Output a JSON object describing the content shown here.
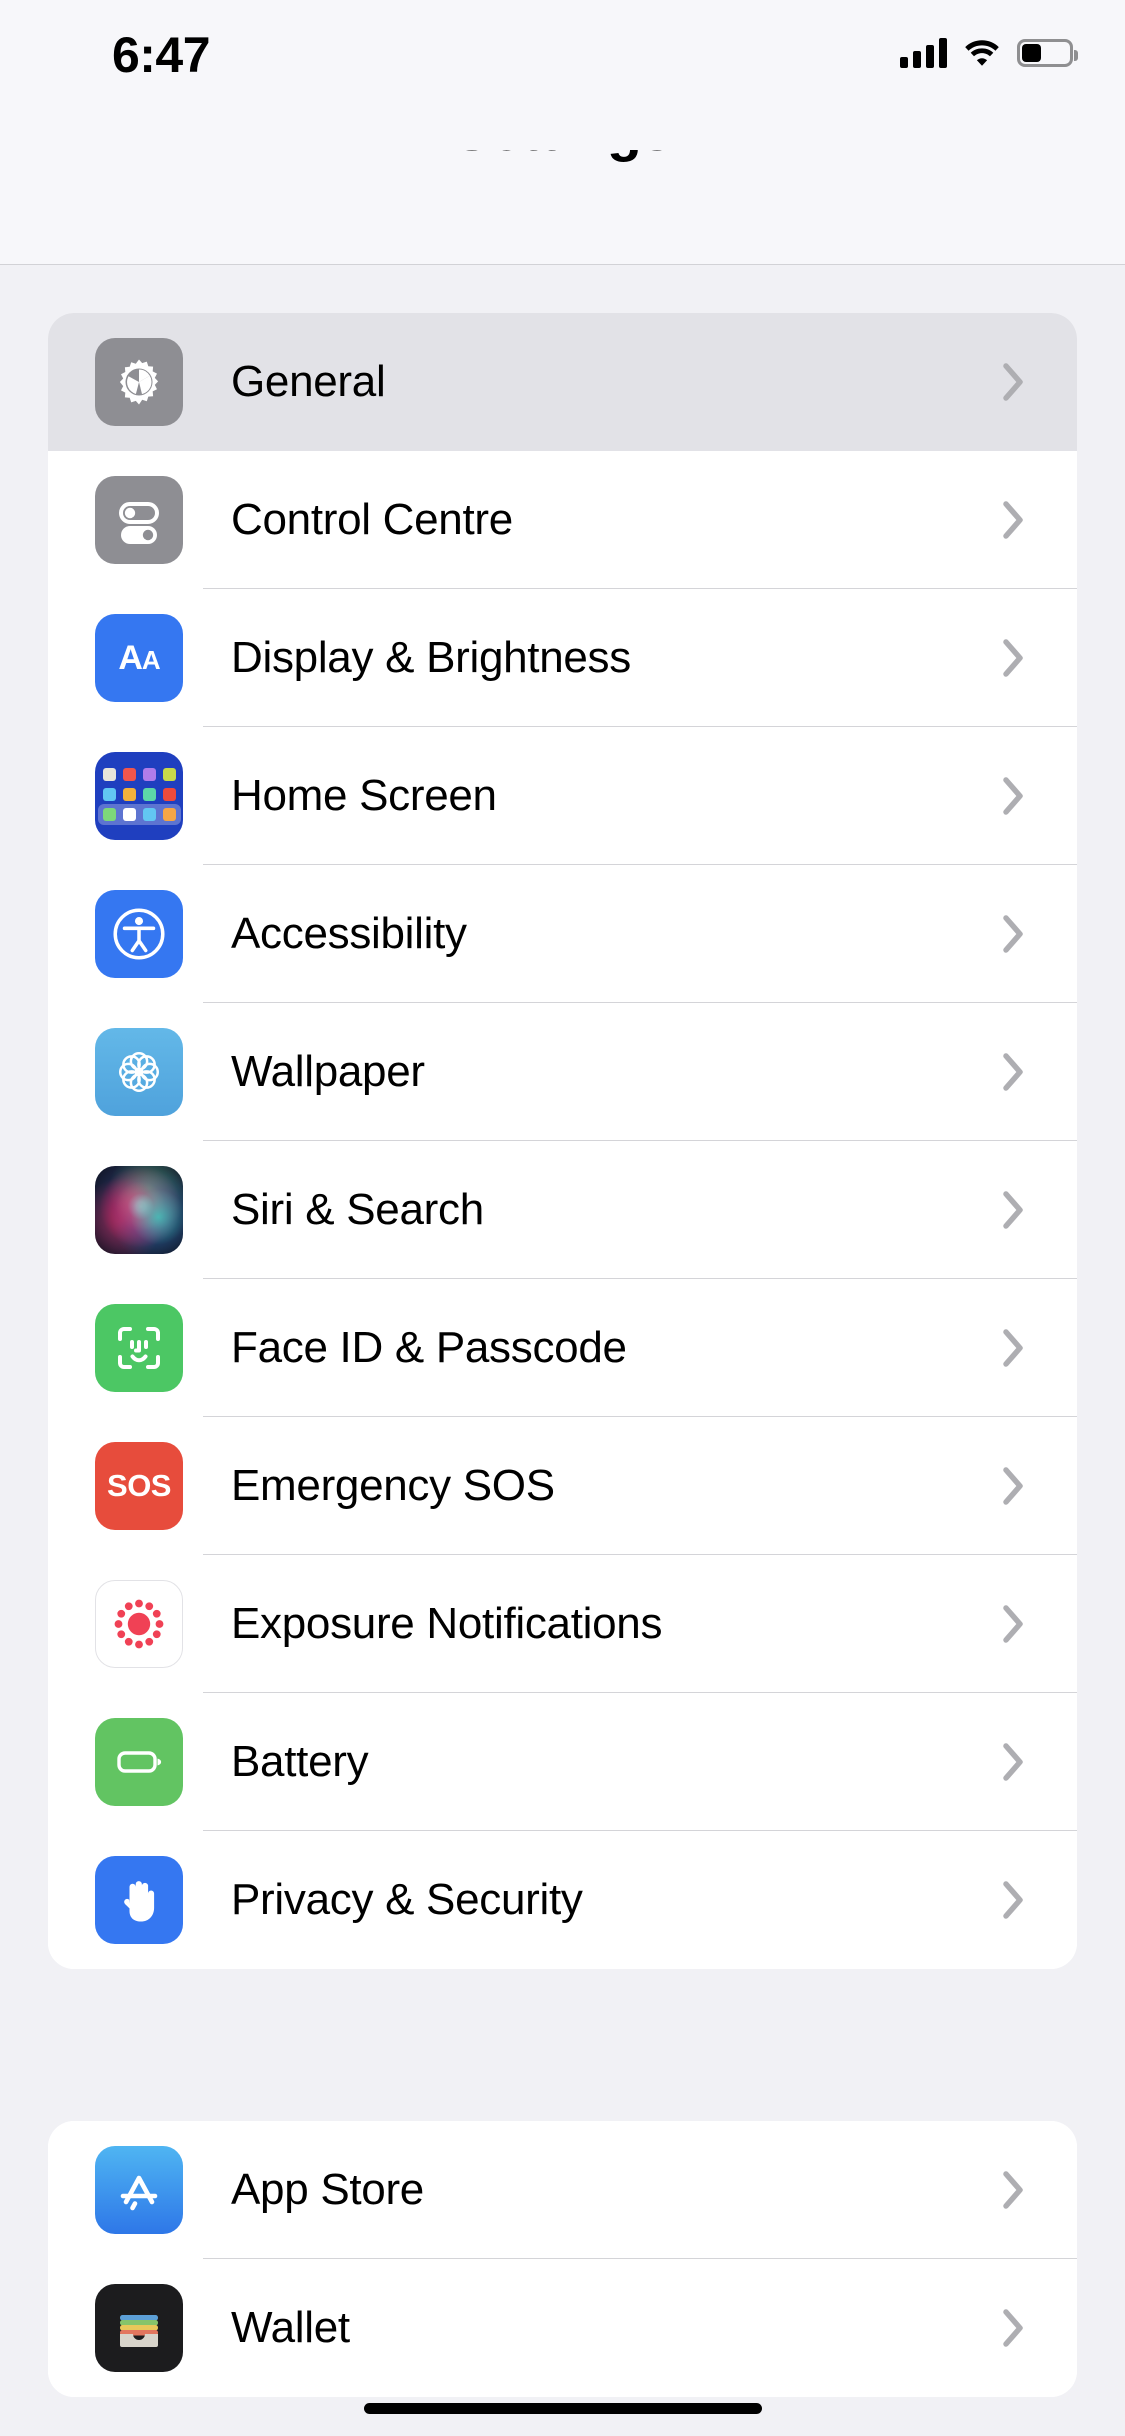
{
  "status_bar": {
    "time": "6:47",
    "cellular_icon": "cellular-bars-icon",
    "cellular_bars": 4,
    "wifi_icon": "wifi-icon",
    "battery_icon": "battery-icon",
    "battery_level_percent": 38
  },
  "header": {
    "title": "Settings"
  },
  "sections": [
    {
      "id": "system",
      "rows": [
        {
          "label": "General",
          "icon": "gear-icon",
          "icon_class": "ic-general",
          "selected": true,
          "chevron": "chevron-right-icon"
        },
        {
          "label": "Control Centre",
          "icon": "control-centre-icon",
          "icon_class": "ic-control",
          "selected": false,
          "chevron": "chevron-right-icon"
        },
        {
          "label": "Display & Brightness",
          "icon": "display-brightness-icon",
          "icon_class": "ic-display",
          "selected": false,
          "chevron": "chevron-right-icon"
        },
        {
          "label": "Home Screen",
          "icon": "home-screen-icon",
          "icon_class": "ic-home",
          "selected": false,
          "chevron": "chevron-right-icon"
        },
        {
          "label": "Accessibility",
          "icon": "accessibility-icon",
          "icon_class": "ic-access",
          "selected": false,
          "chevron": "chevron-right-icon"
        },
        {
          "label": "Wallpaper",
          "icon": "wallpaper-icon",
          "icon_class": "ic-wall",
          "selected": false,
          "chevron": "chevron-right-icon"
        },
        {
          "label": "Siri & Search",
          "icon": "siri-icon",
          "icon_class": "ic-siri",
          "selected": false,
          "chevron": "chevron-right-icon"
        },
        {
          "label": "Face ID & Passcode",
          "icon": "face-id-icon",
          "icon_class": "ic-face",
          "selected": false,
          "chevron": "chevron-right-icon"
        },
        {
          "label": "Emergency SOS",
          "icon": "emergency-sos-icon",
          "icon_class": "ic-sos",
          "selected": false,
          "chevron": "chevron-right-icon"
        },
        {
          "label": "Exposure Notifications",
          "icon": "exposure-notifications-icon",
          "icon_class": "ic-expo",
          "selected": false,
          "chevron": "chevron-right-icon"
        },
        {
          "label": "Battery",
          "icon": "battery-settings-icon",
          "icon_class": "ic-batt",
          "selected": false,
          "chevron": "chevron-right-icon"
        },
        {
          "label": "Privacy & Security",
          "icon": "privacy-hand-icon",
          "icon_class": "ic-priv",
          "selected": false,
          "chevron": "chevron-right-icon"
        }
      ]
    },
    {
      "id": "stores",
      "rows": [
        {
          "label": "App Store",
          "icon": "app-store-icon",
          "icon_class": "ic-appstore",
          "selected": false,
          "chevron": "chevron-right-icon"
        },
        {
          "label": "Wallet",
          "icon": "wallet-icon",
          "icon_class": "ic-wallet",
          "selected": false,
          "chevron": "chevron-right-icon"
        }
      ]
    }
  ],
  "icon_labels": {
    "display_brightness_text": "AA",
    "emergency_sos_text": "SOS"
  },
  "colors": {
    "page_background": "#F1F1F5",
    "card_background": "#FFFFFF",
    "selected_row": "#E2E2E7",
    "separator": "#D4D4D8",
    "chevron": "#AEAEB2",
    "label_text": "#000000",
    "accent_blue": "#3577F1",
    "green": "#4CC764",
    "red": "#E74C3C",
    "gray_icon": "#8E8E93"
  },
  "home_indicator": "home-indicator"
}
